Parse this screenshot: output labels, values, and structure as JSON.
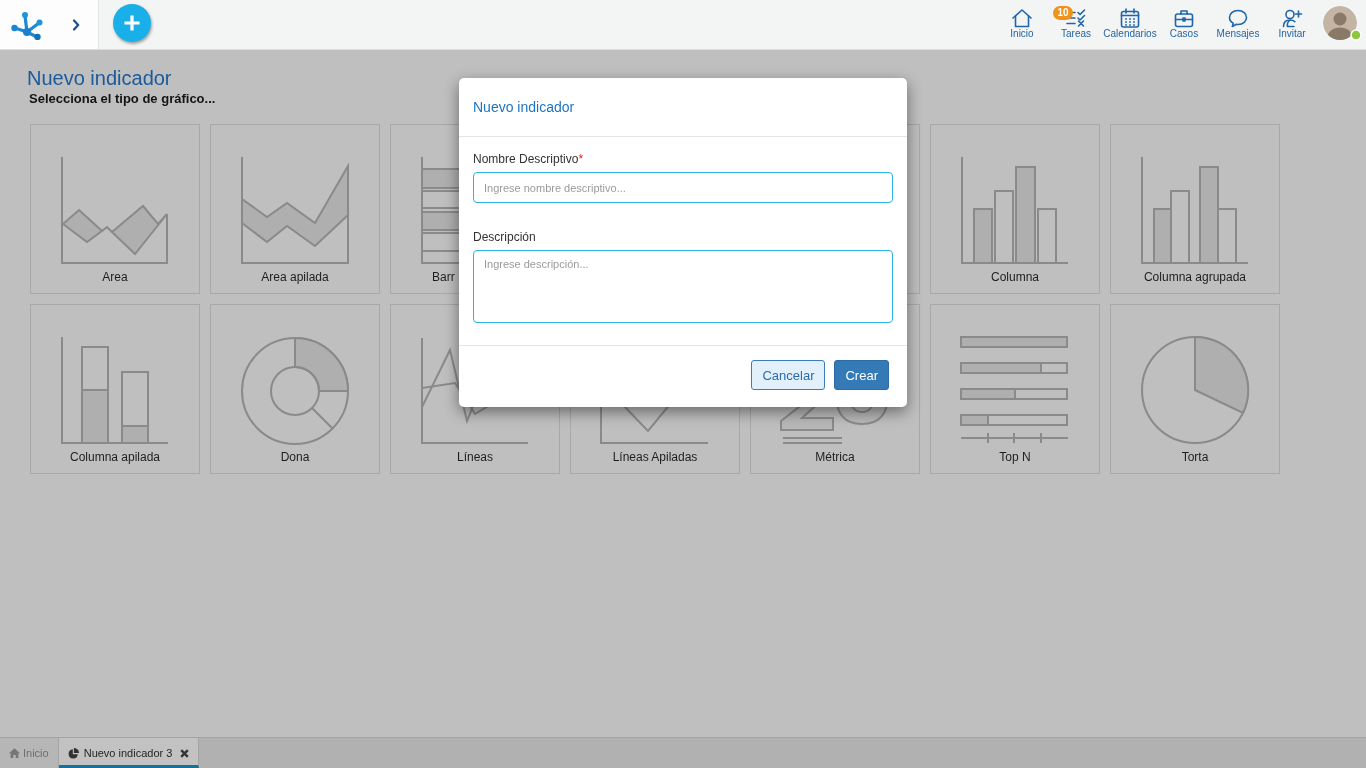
{
  "app_bar": {
    "nav_items": [
      {
        "kind": "home",
        "label": "Inicio"
      },
      {
        "kind": "tasks",
        "label": "Tareas",
        "badge": "10"
      },
      {
        "kind": "calendar",
        "label": "Calendarios"
      },
      {
        "kind": "cases",
        "label": "Casos"
      },
      {
        "kind": "messages",
        "label": "Mensajes"
      },
      {
        "kind": "invite",
        "label": "Invitar"
      }
    ],
    "user": {
      "online": true
    }
  },
  "page": {
    "title": "Nuevo indicador",
    "subtitle": "Selecciona el tipo de gráfico...",
    "chart_types": [
      {
        "kind": "area",
        "label": "Area"
      },
      {
        "kind": "stacked-area",
        "label": "Area apilada"
      },
      {
        "kind": "bar",
        "label": "Barr",
        "cut_off": true
      },
      {
        "kind": "column",
        "label": "Columna"
      },
      {
        "kind": "grouped-column",
        "label": "Columna agrupada"
      },
      {
        "kind": "stacked-column",
        "label": "Columna apilada"
      },
      {
        "kind": "donut",
        "label": "Dona"
      },
      {
        "kind": "line",
        "label": "Líneas"
      },
      {
        "kind": "stacked-line",
        "label": "Líneas Apiladas"
      },
      {
        "kind": "metric",
        "label": "Métrica"
      },
      {
        "kind": "top-n",
        "label": "Top N"
      },
      {
        "kind": "pie",
        "label": "Torta"
      }
    ]
  },
  "dialog": {
    "title": "Nuevo indicador",
    "fields": [
      {
        "kind": "input",
        "label": "Nombre Descriptivo",
        "required_mark": "*",
        "placeholder": "Ingrese nombre descriptivo..."
      },
      {
        "kind": "textarea",
        "label": "Descripción",
        "placeholder": "Ingrese descripción..."
      }
    ],
    "buttons": [
      {
        "kind": "secondary",
        "label": "Cancelar"
      },
      {
        "kind": "primary",
        "label": "Crear"
      }
    ]
  },
  "tab_bar": {
    "tabs": [
      {
        "kind": "home",
        "label": "Inicio",
        "selected": false,
        "closable": false
      },
      {
        "kind": "indicator",
        "label": "Nuevo indicador 3",
        "selected": true,
        "closable": true
      }
    ]
  }
}
